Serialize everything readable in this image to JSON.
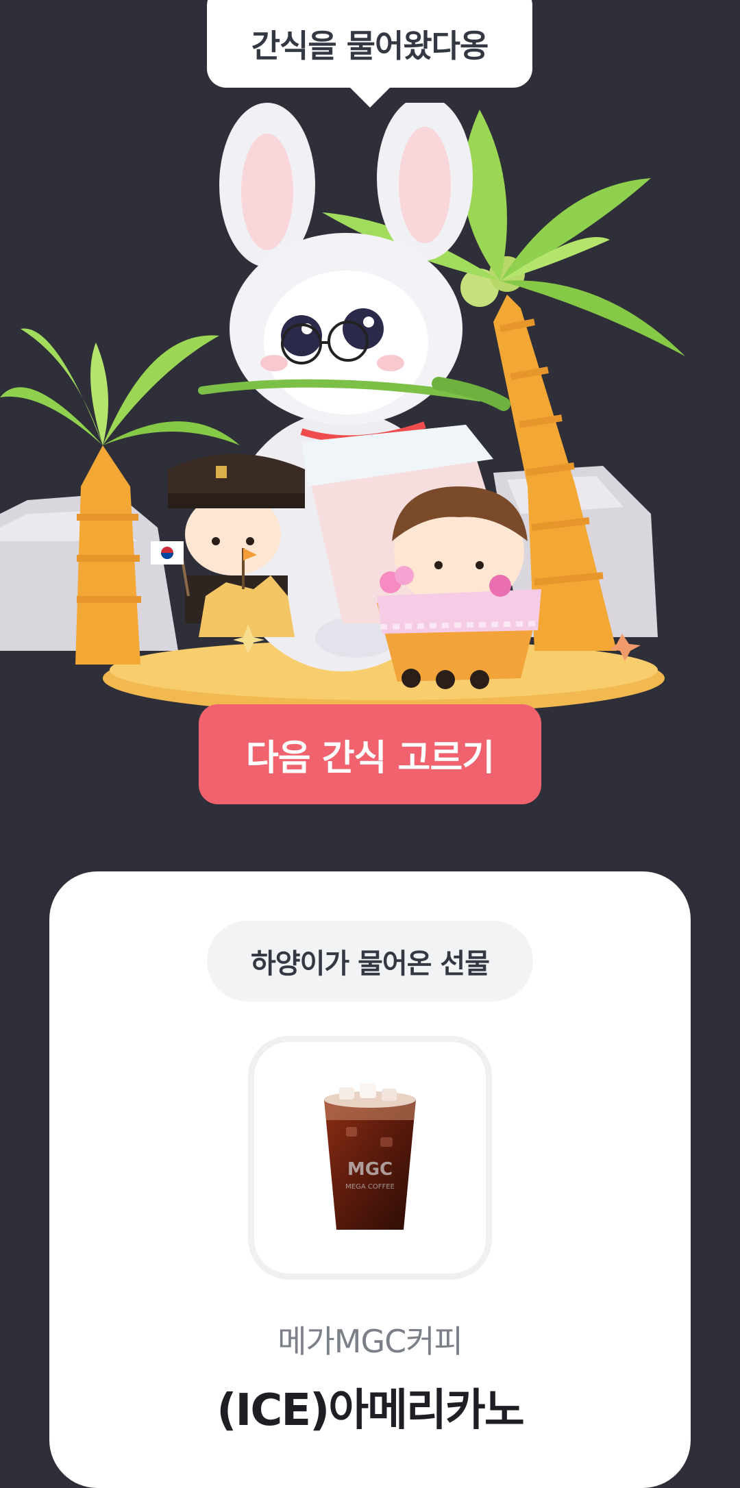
{
  "speech_bubble": {
    "text": "간식을 물어왔다옹"
  },
  "cta": {
    "label": "다음 간식 고르기"
  },
  "gift_card": {
    "badge": "하양이가 물어온 선물",
    "brand": "메가MGC커피",
    "product": "(ICE)아메리카노"
  },
  "product_image": {
    "cup_print": "MGC",
    "cup_print_sub": "MEGA COFFEE"
  },
  "colors": {
    "background": "#2f2f39",
    "accent": "#f0626d",
    "card": "#ffffff"
  },
  "icons": [
    "bunny-character",
    "palm-tree",
    "iced-americano-cup"
  ]
}
